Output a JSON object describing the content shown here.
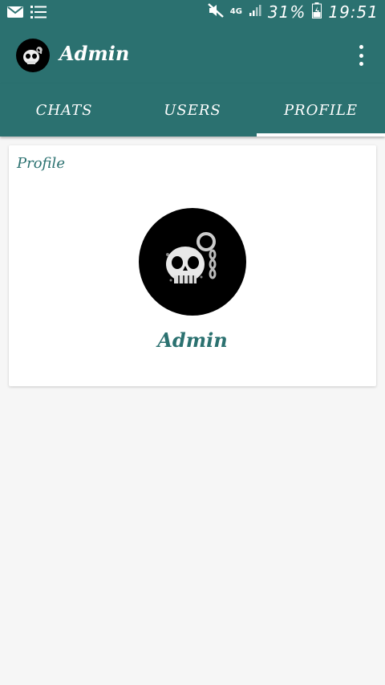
{
  "status_bar": {
    "network": "4G",
    "battery": "31%",
    "time": "19:51",
    "icons": [
      "mail-icon",
      "list-icon",
      "mute-icon",
      "signal-icon",
      "battery-icon"
    ]
  },
  "app_bar": {
    "title": "Admin",
    "avatar_icon": "skull-avatar-icon",
    "menu_icon": "overflow-menu-icon"
  },
  "tabs": [
    {
      "label": "CHATS",
      "active": false
    },
    {
      "label": "USERS",
      "active": false
    },
    {
      "label": "PROFILE",
      "active": true
    }
  ],
  "profile": {
    "section_label": "Profile",
    "name": "Admin",
    "avatar_icon": "skull-avatar-icon"
  },
  "colors": {
    "primary": "#2b7170",
    "background": "#f6f6f6",
    "card": "#ffffff",
    "text_on_primary": "#ffffff"
  }
}
